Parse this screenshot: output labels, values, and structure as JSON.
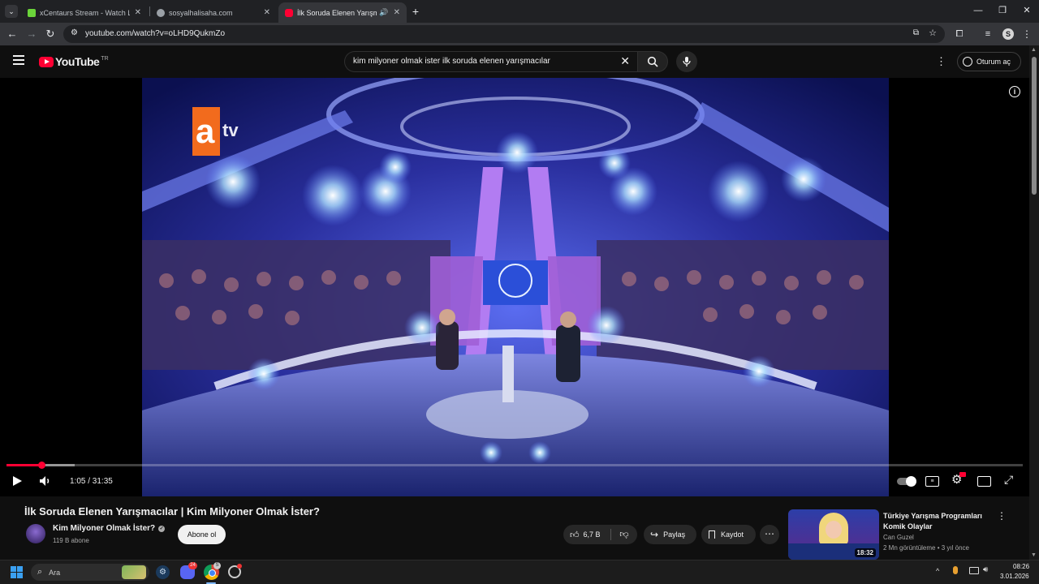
{
  "browser": {
    "tabs": [
      {
        "title": "xCentaurs Stream - Watch Live",
        "fav_color": "#6bd43a"
      },
      {
        "title": "sosyalhalisaha.com",
        "fav_color": "#9aa0a6"
      },
      {
        "title": "İlk Soruda Elenen Yarışmacı",
        "fav_color": "#ff0033"
      }
    ],
    "new_tab": "+",
    "url": "youtube.com/watch?v=oLHD9QukmZo",
    "profile_initial": "S"
  },
  "youtube": {
    "logo_text": "YouTube",
    "region": "TR",
    "search_value": "kim milyoner olmak ister ilk soruda elenen yarışmacılar",
    "signin_label": "Oturum aç"
  },
  "player": {
    "time": "1:05 / 31:35",
    "progress": 0.034,
    "buffered": 0.067,
    "watermark": "atv"
  },
  "video": {
    "title": "İlk Soruda Elenen Yarışmacılar | Kim Milyoner Olmak İster?",
    "channel": "Kim Milyoner Olmak İster?",
    "subscribers": "119 B abone",
    "subscribe_label": "Abone ol",
    "likes": "6,7 B",
    "share_label": "Paylaş",
    "save_label": "Kaydot"
  },
  "related": {
    "title": "Türkiye Yarışma Programları Komik Olaylar",
    "channel": "Can Guzel",
    "meta": "2 Mn görüntüleme • 3 yıl önce",
    "duration": "18:32"
  },
  "taskbar": {
    "search_placeholder": "Ara",
    "time": "08:26",
    "date": "3.01.2026",
    "badges": {
      "discord": "24",
      "chrome": "S"
    }
  }
}
